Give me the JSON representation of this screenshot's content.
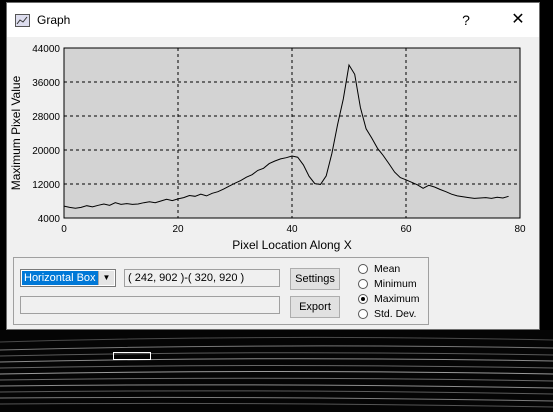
{
  "window": {
    "title": "Graph",
    "help_glyph": "?",
    "close_glyph": "✕"
  },
  "controls": {
    "region_select": "Horizontal Box",
    "coordinates": "( 242, 902 )-( 320, 920 )",
    "status_text": "",
    "settings_label": "Settings",
    "export_label": "Export",
    "stat_options": [
      {
        "label": "Mean",
        "checked": false
      },
      {
        "label": "Minimum",
        "checked": false
      },
      {
        "label": "Maximum",
        "checked": true
      },
      {
        "label": "Std. Dev.",
        "checked": false
      }
    ]
  },
  "chart_data": {
    "type": "line",
    "title": "",
    "xlabel": "Pixel Location Along X",
    "ylabel": "Maximum Pixel Value",
    "xlim": [
      0,
      80
    ],
    "ylim": [
      4000,
      44000
    ],
    "x_ticks": [
      "0",
      "20",
      "40",
      "60",
      "80"
    ],
    "y_ticks": [
      "4000",
      "12000",
      "20000",
      "28000",
      "36000",
      "44000"
    ],
    "grid": true,
    "background": "#d3d3d3",
    "line_color": "#000000",
    "x": [
      0,
      1,
      2,
      3,
      4,
      5,
      6,
      7,
      8,
      9,
      10,
      11,
      12,
      13,
      14,
      15,
      16,
      17,
      18,
      19,
      20,
      21,
      22,
      23,
      24,
      25,
      26,
      27,
      28,
      29,
      30,
      31,
      32,
      33,
      34,
      35,
      36,
      37,
      38,
      39,
      40,
      41,
      42,
      43,
      44,
      45,
      46,
      47,
      48,
      49,
      50,
      51,
      52,
      53,
      54,
      55,
      56,
      57,
      58,
      59,
      60,
      61,
      62,
      63,
      64,
      65,
      66,
      67,
      68,
      69,
      70,
      71,
      72,
      73,
      74,
      75,
      76,
      77,
      78
    ],
    "y": [
      6800,
      6500,
      6300,
      6500,
      6900,
      6600,
      7000,
      7300,
      7000,
      7600,
      7200,
      7400,
      7200,
      7300,
      7600,
      7800,
      7600,
      8000,
      8400,
      8100,
      8500,
      8800,
      9300,
      9100,
      9600,
      9200,
      9800,
      10200,
      10800,
      11500,
      12200,
      12800,
      13600,
      14200,
      15200,
      15700,
      16800,
      17400,
      17900,
      18200,
      18600,
      18300,
      16500,
      13800,
      12100,
      11900,
      13900,
      19200,
      26000,
      32000,
      40000,
      37800,
      30000,
      25000,
      22800,
      20400,
      18700,
      16800,
      14800,
      13500,
      13000,
      12400,
      11800,
      11000,
      11700,
      11300,
      10700,
      10200,
      9600,
      9200,
      9000,
      8800,
      8600,
      8700,
      8800,
      8600,
      8900,
      8700,
      9100
    ]
  }
}
